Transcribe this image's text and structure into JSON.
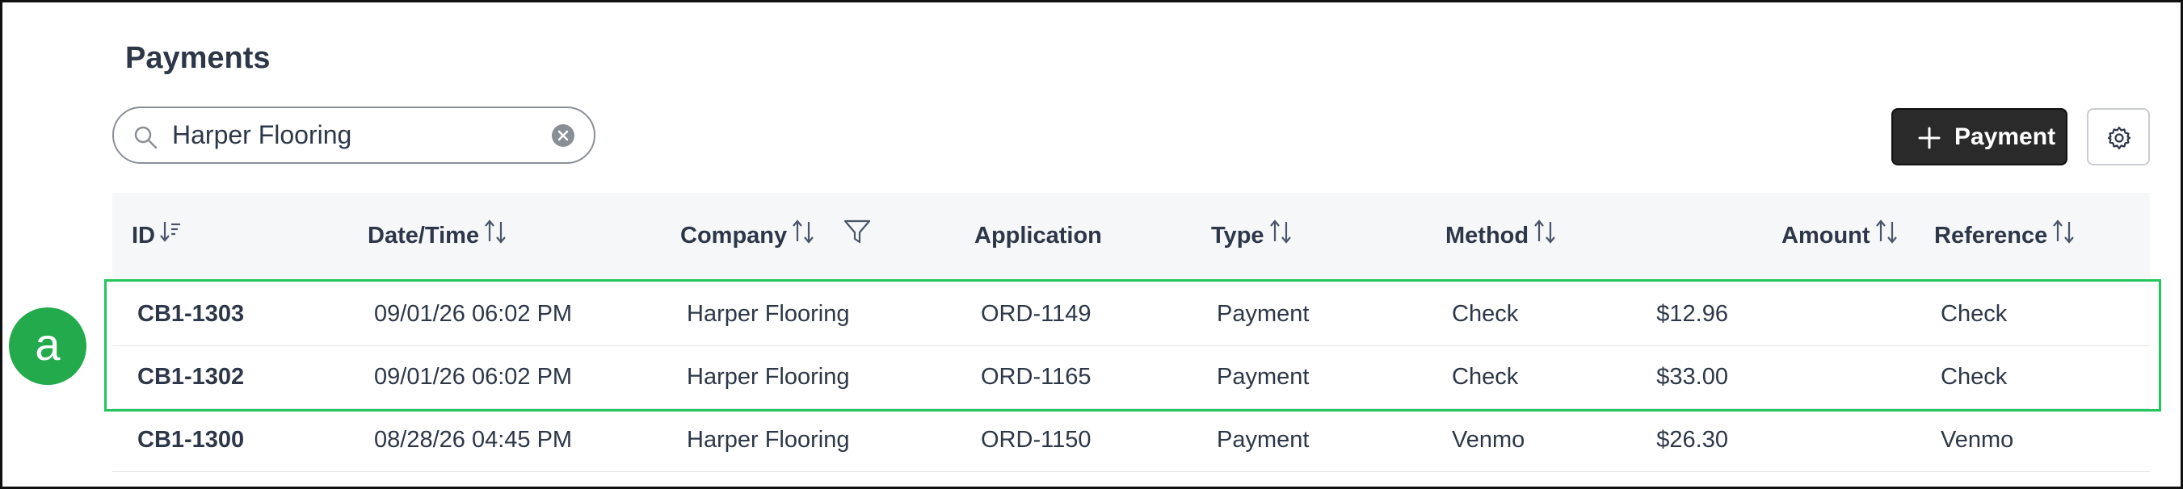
{
  "page": {
    "title": "Payments"
  },
  "search": {
    "value": "Harper Flooring"
  },
  "toolbar": {
    "add_payment_label": "Payment"
  },
  "table": {
    "columns": [
      {
        "key": "id",
        "label": "ID",
        "sort": "sorted-desc"
      },
      {
        "key": "datetime",
        "label": "Date/Time",
        "sort": "sortable"
      },
      {
        "key": "company",
        "label": "Company",
        "sort": "sortable",
        "filter": true
      },
      {
        "key": "application",
        "label": "Application"
      },
      {
        "key": "type",
        "label": "Type",
        "sort": "sortable"
      },
      {
        "key": "method",
        "label": "Method",
        "sort": "sortable"
      },
      {
        "key": "amount",
        "label": "Amount",
        "sort": "sortable"
      },
      {
        "key": "reference",
        "label": "Reference",
        "sort": "sortable"
      }
    ],
    "rows": [
      {
        "id": "CB1-1303",
        "datetime": "09/01/26 06:02 PM",
        "company": "Harper Flooring",
        "application": "ORD-1149",
        "type": "Payment",
        "method": "Check",
        "amount": "$12.96",
        "reference": "Check"
      },
      {
        "id": "CB1-1302",
        "datetime": "09/01/26 06:02 PM",
        "company": "Harper Flooring",
        "application": "ORD-1165",
        "type": "Payment",
        "method": "Check",
        "amount": "$33.00",
        "reference": "Check"
      },
      {
        "id": "CB1-1300",
        "datetime": "08/28/26 04:45 PM",
        "company": "Harper Flooring",
        "application": "ORD-1150",
        "type": "Payment",
        "method": "Venmo",
        "amount": "$26.30",
        "reference": "Venmo"
      }
    ]
  },
  "annotation": {
    "label": "a",
    "color": "#22c55e"
  },
  "colors": {
    "primary_button": "#2a2a2a",
    "header_bg": "#f6f7f9",
    "highlight": "#22c55e"
  },
  "icons": {
    "search": "search-icon",
    "clear": "clear-icon",
    "add": "plus-icon",
    "settings": "gear-icon",
    "sort": "sort-icon",
    "filter": "filter-icon"
  }
}
